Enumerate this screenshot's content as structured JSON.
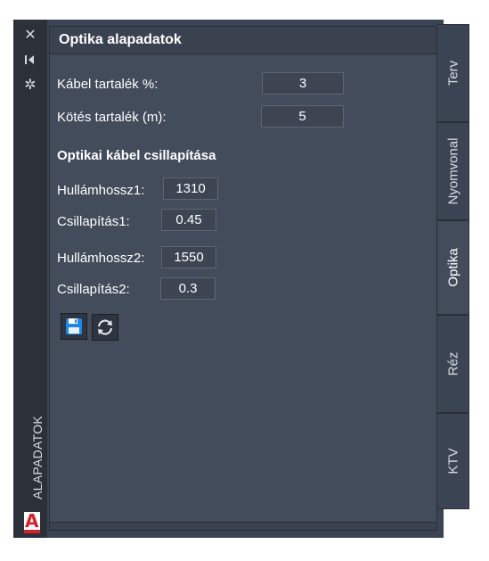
{
  "panel": {
    "title": "Optika alapadatok",
    "vertical_title": "ALAPADATOK"
  },
  "leftbar": {
    "close_glyph": "✕",
    "autohide_glyph": "⧏",
    "settings_glyph": "✲"
  },
  "fields": {
    "kabel_tartalek": {
      "label": "Kábel tartalék %:",
      "value": "3"
    },
    "kotes_tartalek": {
      "label": "Kötés tartalék (m):",
      "value": "5"
    },
    "section_title": "Optikai kábel csillapítása",
    "hullamhossz1": {
      "label": "Hullámhossz1:",
      "value": "1310"
    },
    "csillapitas1": {
      "label": "Csillapítás1:",
      "value": "0.45"
    },
    "hullamhossz2": {
      "label": "Hullámhossz2:",
      "value": "1550"
    },
    "csillapitas2": {
      "label": "Csillapítás2:",
      "value": "0.3"
    }
  },
  "buttons": {
    "save_icon": "floppy-disk-icon",
    "refresh_icon": "refresh-icon"
  },
  "tabs": [
    {
      "label": "Terv",
      "active": false
    },
    {
      "label": "Nyomvonal",
      "active": false
    },
    {
      "label": "Optika",
      "active": true
    },
    {
      "label": "Réz",
      "active": false
    },
    {
      "label": "KTV",
      "active": false
    }
  ],
  "logo_letter": "A",
  "colors": {
    "accent_blue": "#1e88e5",
    "logo_red": "#d4202a"
  }
}
